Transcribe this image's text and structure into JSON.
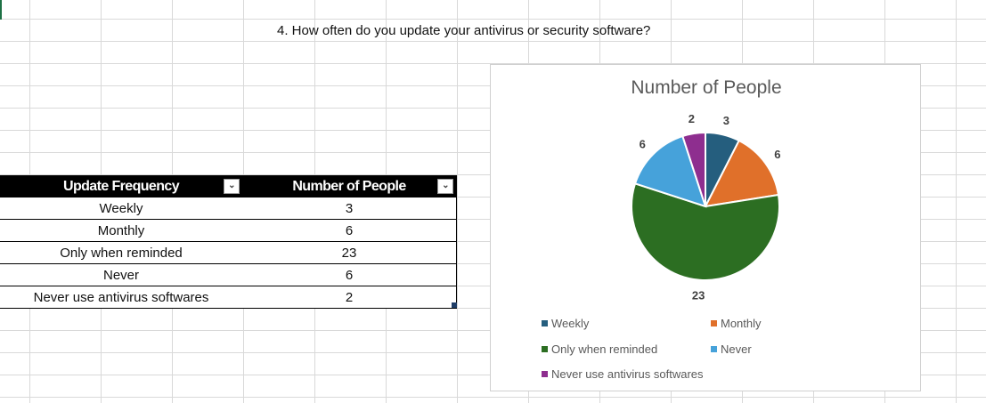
{
  "question": "4. How often do you update your antivirus or security software?",
  "table": {
    "headers": [
      "Update Frequency",
      "Number of People"
    ],
    "filter_icon": "chevron-down-icon",
    "rows": [
      {
        "label": "Weekly",
        "value": "3"
      },
      {
        "label": "Monthly",
        "value": "6"
      },
      {
        "label": "Only when reminded",
        "value": "23"
      },
      {
        "label": "Never",
        "value": "6"
      },
      {
        "label": "Never use antivirus softwares",
        "value": "2"
      }
    ]
  },
  "chart_data": {
    "type": "pie",
    "title": "Number of People",
    "categories": [
      "Weekly",
      "Monthly",
      "Only when reminded",
      "Never",
      "Never use antivirus softwares"
    ],
    "values": [
      3,
      6,
      23,
      6,
      2
    ],
    "colors": [
      "#255e7e",
      "#e0702a",
      "#2c6e22",
      "#46a2da",
      "#8e2e8f"
    ],
    "legend_placement": "bottom"
  }
}
